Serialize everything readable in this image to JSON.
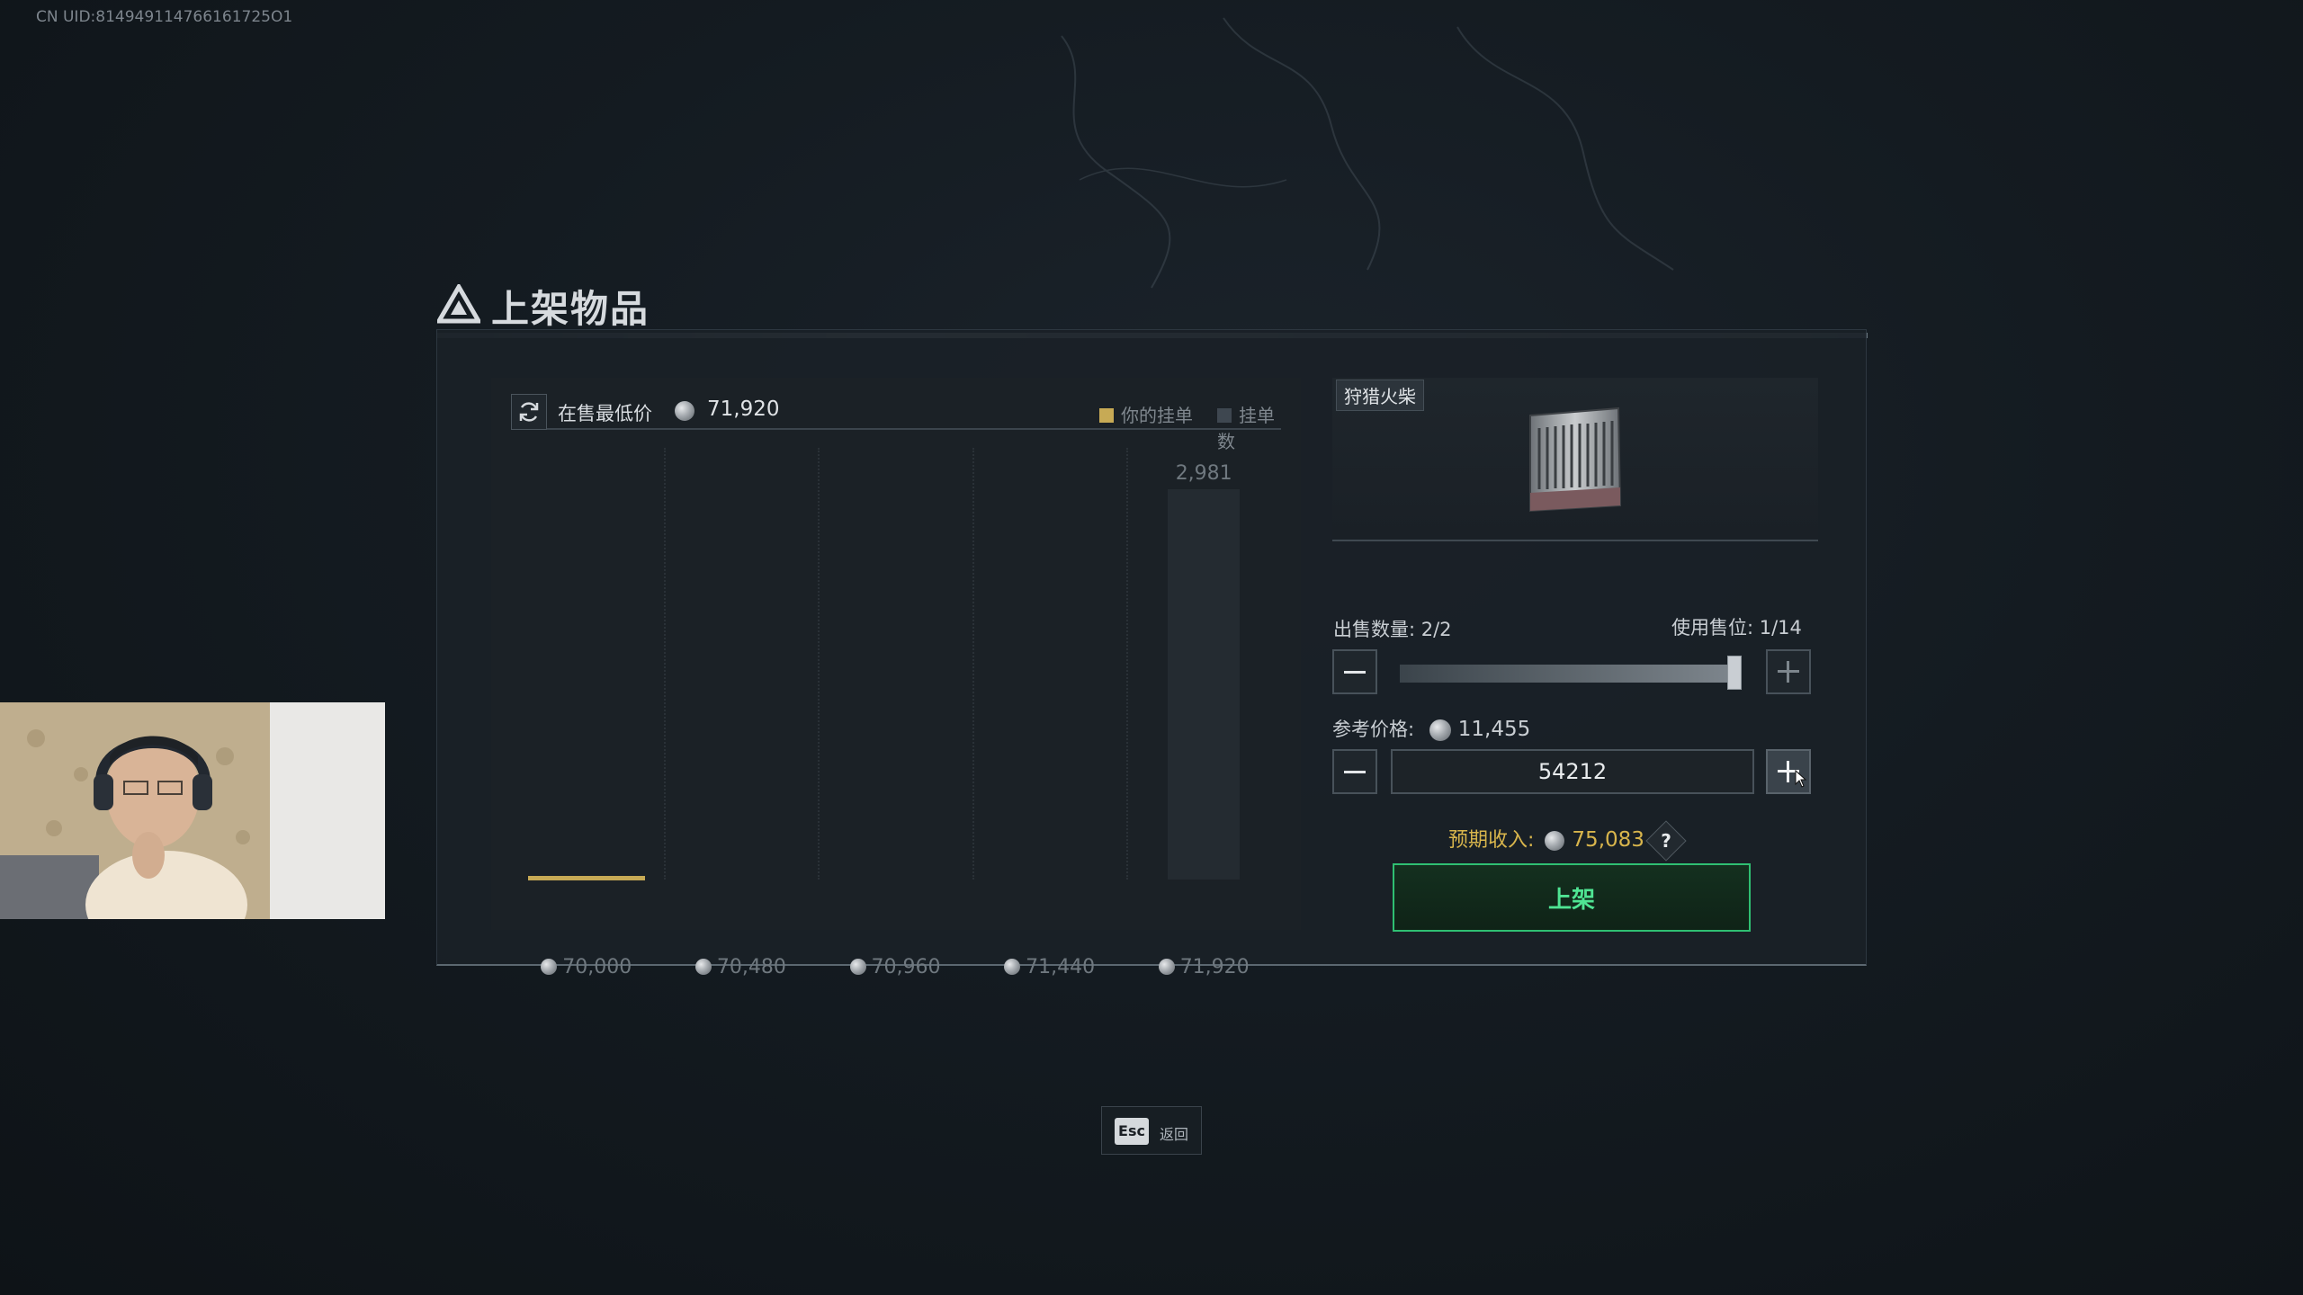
{
  "overlay": {
    "uid": "CN UID:814949114766161725O1"
  },
  "dialog": {
    "title": "上架物品",
    "chart_panel": {
      "lowest_label": "在售最低价",
      "lowest_price": "71,920",
      "legend_mine": "你的挂单",
      "legend_count": "挂单数"
    },
    "item": {
      "name": "狩猎火柴"
    },
    "quantity": {
      "label": "出售数量: 2/2",
      "slots": "使用售位: 1/14",
      "value_fraction": 1.0
    },
    "reference_price": {
      "label": "参考价格:",
      "value": "11,455"
    },
    "price_input": {
      "value": "54212"
    },
    "income": {
      "label": "预期收入:",
      "value": "75,083",
      "help": "?"
    },
    "list_button": "上架"
  },
  "footer": {
    "esc_key": "Esc",
    "esc_label": "返回"
  },
  "chart_data": {
    "type": "bar",
    "categories": [
      "70,000",
      "70,480",
      "70,960",
      "71,440",
      "71,920"
    ],
    "series": [
      {
        "name": "挂单数",
        "values": [
          0,
          0,
          0,
          0,
          2981
        ],
        "labels": [
          "",
          "",
          "",
          "",
          "2,981"
        ]
      },
      {
        "name": "你的挂单",
        "values": [
          2,
          0,
          0,
          0,
          0
        ]
      }
    ],
    "ylim": [
      0,
      3300
    ],
    "colors": {
      "mine": "#c7aa55",
      "count": "#242b31"
    }
  }
}
